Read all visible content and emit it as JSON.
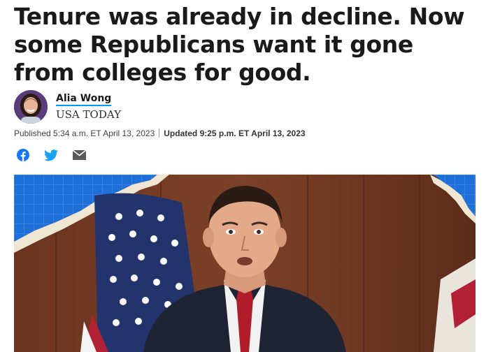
{
  "article": {
    "headline": "Tenure was already in decline. Now some Republicans want it gone from colleges for good.",
    "author": {
      "name": "Alia Wong",
      "outlet": "USA TODAY"
    },
    "dateline": {
      "published": "Published 5:34 a.m. ET April 13, 2023",
      "updated": "Updated 9:25 p.m. ET April 13, 2023"
    },
    "share": {
      "icons": [
        "facebook-icon",
        "twitter-icon",
        "email-icon"
      ]
    }
  },
  "colors": {
    "facebook": "#1877f2",
    "twitter": "#1da1f2",
    "email": "#5a5a5a",
    "author_underline": "#009bff",
    "headline": "#1a1a1a"
  }
}
